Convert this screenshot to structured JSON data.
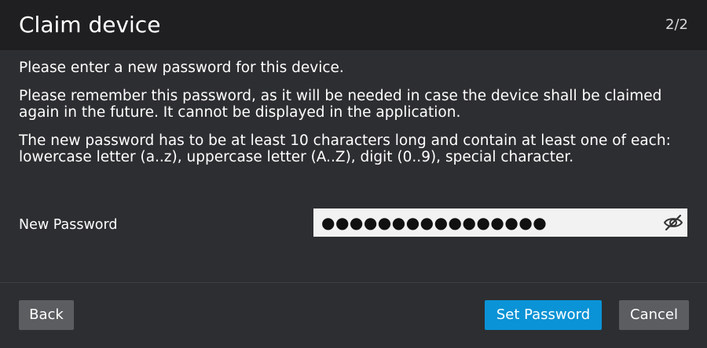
{
  "header": {
    "title": "Claim device",
    "step": "2/2"
  },
  "body": {
    "paragraphs": [
      "Please enter a new password for this device.",
      "Please remember this password, as it will be needed in case the device shall be claimed again in the future. It cannot be displayed in the application.",
      "The new password has to be at least 10 characters long and contain at least one of each: lowercase letter (a..z), uppercase letter (A..Z), digit (0..9), special character."
    ]
  },
  "form": {
    "password_label": "New Password",
    "password_value": "●●●●●●●●●●●●●●●●",
    "visibility_icon": "eye-slash-icon"
  },
  "footer": {
    "back_label": "Back",
    "set_password_label": "Set Password",
    "cancel_label": "Cancel"
  },
  "colors": {
    "background": "#2d2e31",
    "header_background": "#1f1f21",
    "primary_button": "#0a93d6",
    "secondary_button": "#5b5d60"
  }
}
